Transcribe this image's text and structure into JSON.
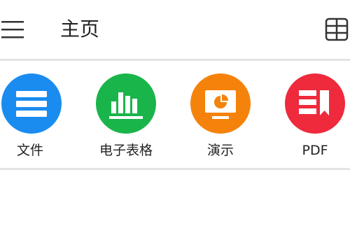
{
  "header": {
    "title": "主页",
    "menu_icon": "hamburger-menu-icon",
    "grid_icon": "grid-view-icon"
  },
  "apps": [
    {
      "label": "文件",
      "icon": "document-icon",
      "color": "#1a8cf0"
    },
    {
      "label": "电子表格",
      "icon": "bar-chart-icon",
      "color": "#1ab54a"
    },
    {
      "label": "演示",
      "icon": "presentation-icon",
      "color": "#f5820a"
    },
    {
      "label": "PDF",
      "icon": "pdf-icon",
      "color": "#ee2a3c"
    }
  ],
  "colors": {
    "divider": "#e3e3e3",
    "text": "#222222"
  }
}
